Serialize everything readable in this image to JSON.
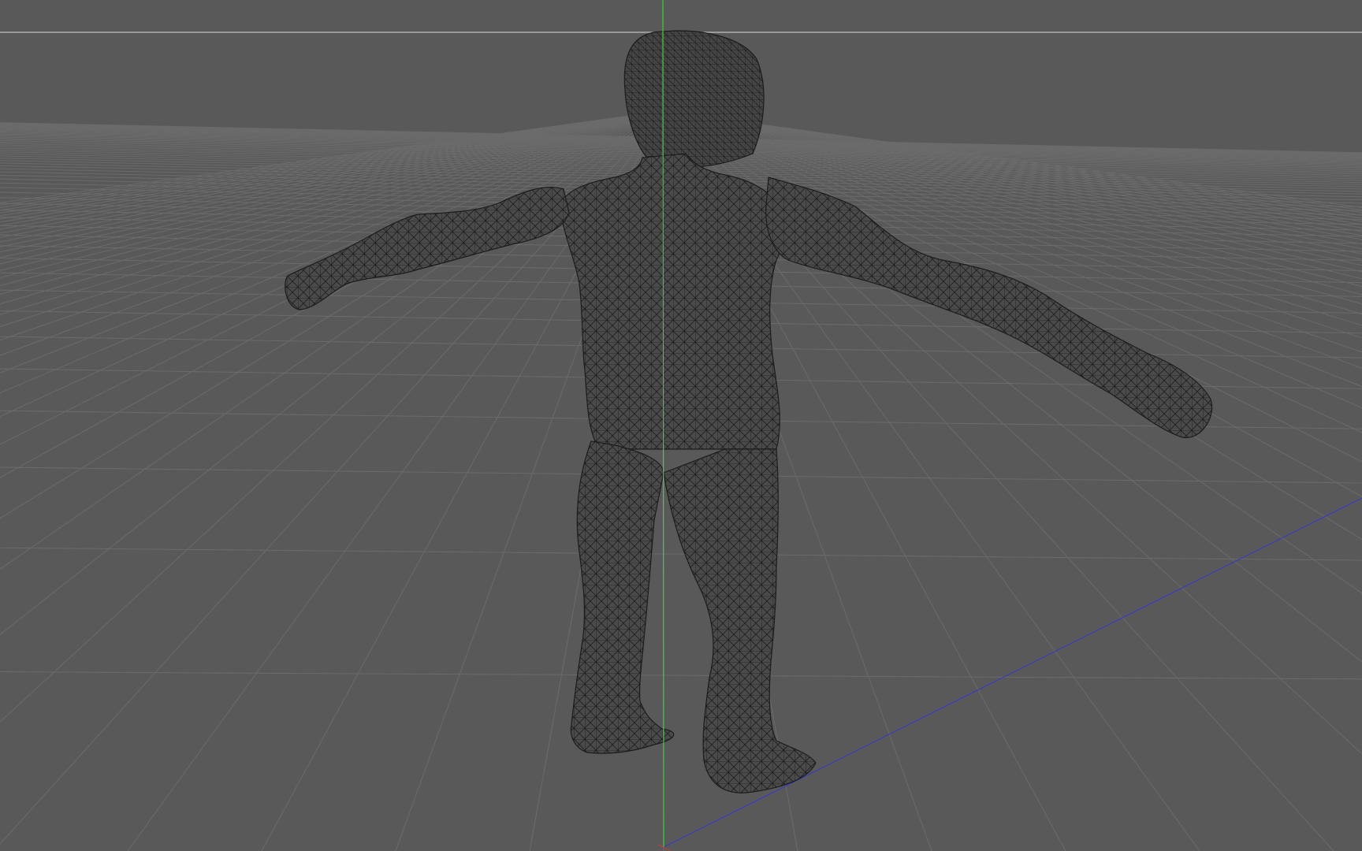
{
  "viewport": {
    "background_color": "#595959",
    "grid_color": "#6b6b6b",
    "horizon_color": "#d9d9d9",
    "axis_y_color": "#3ecf3e",
    "axis_z_color": "#3a3ac8",
    "axis_x_color": "#c83a3a",
    "mesh_fill_color": "#474747",
    "mesh_wire_color": "#1f1f1f",
    "model_icon": "wireframe-human-figure",
    "display_mode": "wireframe",
    "view": "perspective"
  }
}
